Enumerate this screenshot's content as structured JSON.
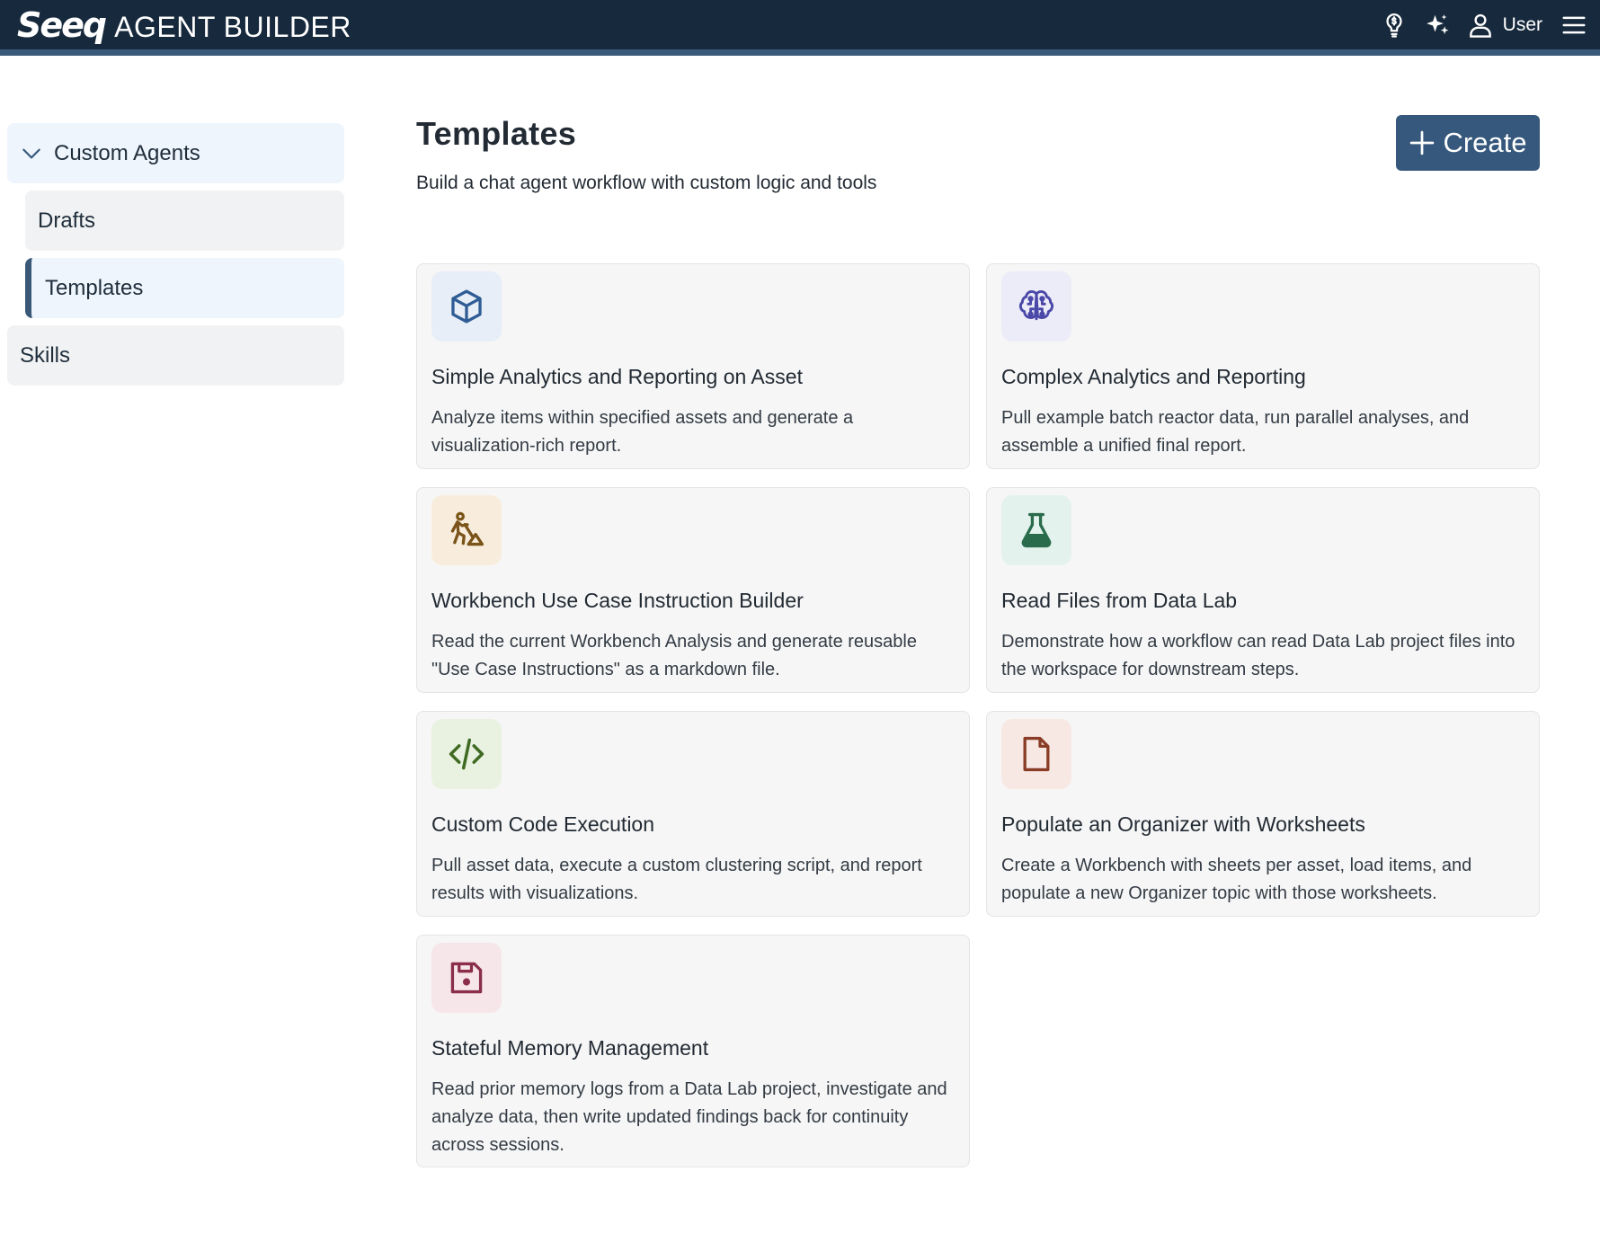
{
  "header": {
    "logo": "Seeq",
    "app_name": "AGENT BUILDER",
    "icons": [
      "lightbulb-icon",
      "sparkles-icon",
      "user-icon",
      "menu-icon"
    ],
    "user_label": "User"
  },
  "sidebar": {
    "group_label": "Custom Agents",
    "items": [
      {
        "label": "Drafts",
        "active": false
      },
      {
        "label": "Templates",
        "active": true
      }
    ],
    "skills_label": "Skills"
  },
  "main": {
    "title": "Templates",
    "subtitle": "Build a chat agent workflow with custom logic and tools",
    "create_label": "Create",
    "cards": [
      {
        "icon": "cube-icon",
        "icon_bg": "#e7eef7",
        "icon_color": "#2f5c94",
        "title": "Simple Analytics and Reporting on Asset",
        "description": "Analyze items within specified assets and generate a visualization-rich report."
      },
      {
        "icon": "brain-icon",
        "icon_bg": "#ecebf8",
        "icon_color": "#4a48a8",
        "title": "Complex Analytics and Reporting",
        "description": "Pull example batch reactor data, run parallel analyses, and assemble a unified final report."
      },
      {
        "icon": "excavator-worker-icon",
        "icon_bg": "#f8eddd",
        "icon_color": "#7a5418",
        "title": "Workbench Use Case Instruction Builder",
        "description": "Read the current Workbench Analysis and generate reusable \"Use Case Instructions\" as a markdown file."
      },
      {
        "icon": "flask-icon",
        "icon_bg": "#e3f2ec",
        "icon_color": "#2a6b4c",
        "title": "Read Files from Data Lab",
        "description": "Demonstrate how a workflow can read Data Lab project files into the workspace for downstream steps."
      },
      {
        "icon": "code-icon",
        "icon_bg": "#e9f2e1",
        "icon_color": "#3f6a22",
        "title": "Custom Code Execution",
        "description": "Pull asset data, execute a custom clustering script, and report results with visualizations."
      },
      {
        "icon": "file-icon",
        "icon_bg": "#f8e8e4",
        "icon_color": "#8a3d26",
        "title": "Populate an Organizer with Worksheets",
        "description": "Create a Workbench with sheets per asset, load items, and populate a new Organizer topic with those worksheets."
      },
      {
        "icon": "floppy-disk-icon",
        "icon_bg": "#f6e6ea",
        "icon_color": "#8a2e4a",
        "title": "Stateful Memory Management",
        "description": "Read prior memory logs from a Data Lab project, investigate and analyze data, then write updated findings back for continuity across sessions."
      }
    ]
  }
}
